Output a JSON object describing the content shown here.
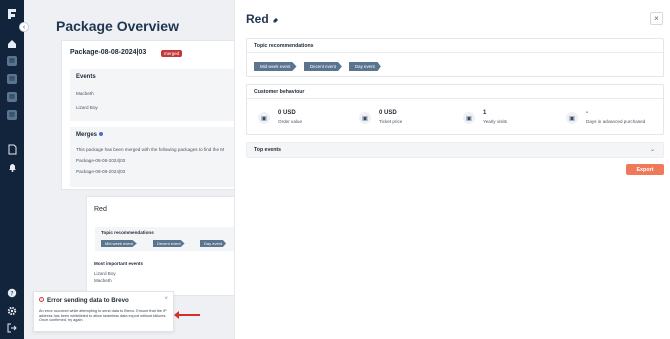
{
  "sidebar": {
    "icons": [
      "logo-icon",
      "home-icon",
      "grid-icon-1",
      "grid-icon-2",
      "grid-icon-3",
      "grid-icon-4",
      "document-icon",
      "bell-icon",
      "help-icon",
      "gear-icon",
      "logout-icon"
    ]
  },
  "overview": {
    "title": "Package Overview",
    "package_name": "Package-08-08-2024|03",
    "badge": "merged",
    "events_heading": "Events",
    "events": [
      "Macbeth",
      "Lizard Boy"
    ],
    "merges_heading": "Merges",
    "merges_text": "This package has been merged with the following packages to find the M",
    "merged_packages": [
      "Package-08-08-2024|03",
      "Package-08-08-2024|03"
    ],
    "red_title": "Red",
    "topic_heading": "Topic recommendations",
    "topics": [
      "Mid week event",
      "Decent event",
      "Day event"
    ],
    "important_heading": "Most important events",
    "important_events": [
      "Lizard Boy",
      "Macbeth"
    ]
  },
  "toast": {
    "title": "Error sending data to Brevo",
    "message": "An error occurred while attempting to send data to Brevo. Ensure that the IP address has been whitelisted to allow seamless data export without failures. Once confirmed, try again.",
    "close": "×"
  },
  "panel": {
    "title": "Red",
    "close": "×",
    "topics_heading": "Topic recommendations",
    "topics": [
      "Mid week event",
      "Decent event",
      "Day event"
    ],
    "behaviour_heading": "Customer behaviour",
    "metrics": [
      {
        "value": "0 USD",
        "label": "Order value"
      },
      {
        "value": "0 USD",
        "label": "Ticket price"
      },
      {
        "value": "1",
        "label": "Yearly visits"
      },
      {
        "value": "-",
        "label": "Days in advanced purchased"
      }
    ],
    "events_heading": "Top events",
    "export_label": "Export"
  },
  "colors": {
    "sidebar": "#12243b",
    "tag": "#5a7590",
    "export": "#ef7a5a",
    "error": "#d63a3a",
    "badge": "#c43a3a"
  }
}
